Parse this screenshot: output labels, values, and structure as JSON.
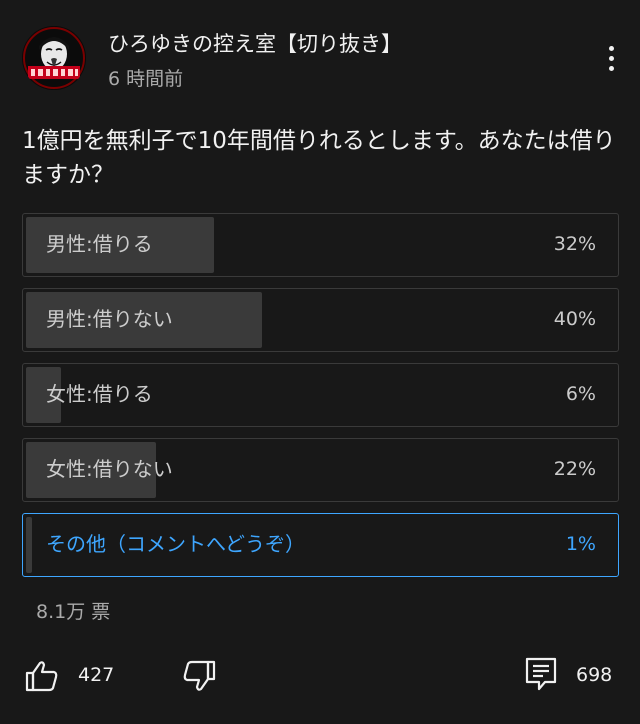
{
  "header": {
    "channel_name": "ひろゆきの控え室【切り抜き】",
    "post_time": "6 時間前",
    "avatar_icon": "masked-face-avatar-icon",
    "menu_icon": "more-vert-icon"
  },
  "post": {
    "question": "1億円を無利子で10年間借りれるとします。あなたは借りますか？"
  },
  "poll": {
    "options": [
      {
        "label": "男性:借りる",
        "percent_text": "32%",
        "percent": 32,
        "selected": false
      },
      {
        "label": "男性:借りない",
        "percent_text": "40%",
        "percent": 40,
        "selected": false
      },
      {
        "label": "女性:借りる",
        "percent_text": "6%",
        "percent": 6,
        "selected": false
      },
      {
        "label": "女性:借りない",
        "percent_text": "22%",
        "percent": 22,
        "selected": false
      },
      {
        "label": "その他（コメントへどうぞ）",
        "percent_text": "1%",
        "percent": 1,
        "selected": true
      }
    ],
    "votes": "8.1万 票"
  },
  "actions": {
    "like_icon": "thumb-up-icon",
    "like_count": "427",
    "dislike_icon": "thumb-down-icon",
    "comment_icon": "comment-icon",
    "comment_count": "698"
  },
  "colors": {
    "background": "#181818",
    "text_primary": "#f1f1f1",
    "text_secondary": "#aaaaaa",
    "bar_fill": "#3a3a3a",
    "accent": "#3ea6ff"
  }
}
